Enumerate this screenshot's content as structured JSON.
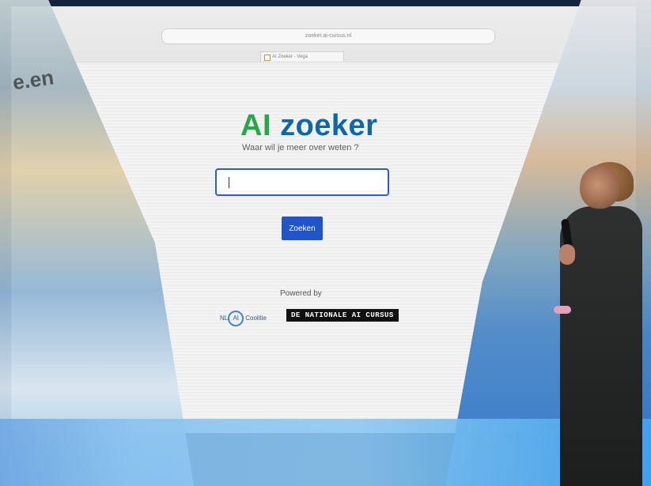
{
  "browser": {
    "url": "zoeker.ai-cursus.nl",
    "tab_title": "AI Zoeker - Vega",
    "nav_symbols": "< >"
  },
  "page": {
    "logo_ai": "AI",
    "logo_zoeker": "zoeker",
    "subtitle": "Waar wil je meer over weten ?",
    "search_button": "Zoeken",
    "powered_by": "Powered by",
    "partner_left": "NLAICoolitie",
    "partner_left_prefix": "NL",
    "partner_left_badge": "AI",
    "partner_left_suffix": "Coolitie",
    "partner_right": "DE NATIONALE AI CURSUS"
  },
  "theme": {
    "ai_color": "#26a84a",
    "zoeker_color": "#0e66ac",
    "button_color": "#1f55c8"
  },
  "environment": {
    "background_text": "e.en"
  }
}
